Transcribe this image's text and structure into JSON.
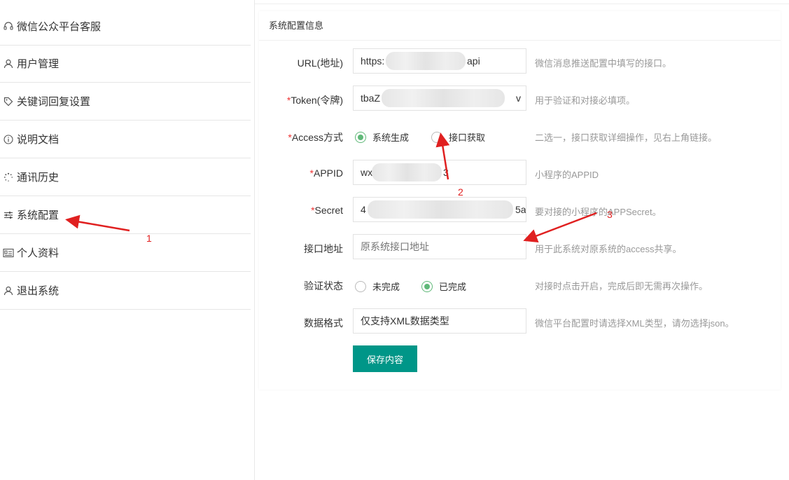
{
  "sidebar": {
    "items": [
      {
        "label": "微信公众平台客服",
        "icon": "headset-icon"
      },
      {
        "label": "用户管理",
        "icon": "user-icon"
      },
      {
        "label": "关键词回复设置",
        "icon": "tag-icon"
      },
      {
        "label": "说明文档",
        "icon": "info-icon"
      },
      {
        "label": "通讯历史",
        "icon": "loading-icon"
      },
      {
        "label": "系统配置",
        "icon": "sliders-icon"
      },
      {
        "label": "个人资料",
        "icon": "profile-card-icon"
      },
      {
        "label": "退出系统",
        "icon": "user-icon"
      }
    ]
  },
  "form": {
    "title": "系统配置信息",
    "url": {
      "label": "URL(地址)",
      "value_start": "https:",
      "value_end": "api",
      "hint": "微信消息推送配置中填写的接口。"
    },
    "token": {
      "required": "*",
      "label": "Token(令牌)",
      "value_start": "tbaZ",
      "value_end": "v",
      "hint": "用于验证和对接必填项。"
    },
    "access": {
      "required": "*",
      "label": "Access方式",
      "options": [
        "系统生成",
        "接口获取"
      ],
      "selected": "系统生成",
      "hint": "二选一，接口获取详细操作，见右上角链接。"
    },
    "appid": {
      "required": "*",
      "label": "APPID",
      "value_start": "wx",
      "value_end": "3",
      "hint": "小程序的APPID"
    },
    "secret": {
      "required": "*",
      "label": "Secret",
      "value_start": "4",
      "value_end": "5a",
      "hint": "要对接的小程序的APPSecret。"
    },
    "interface": {
      "label": "接口地址",
      "placeholder": "原系统接口地址",
      "hint": "用于此系统对原系统的access共享。"
    },
    "verify": {
      "label": "验证状态",
      "options": [
        "未完成",
        "已完成"
      ],
      "selected": "已完成",
      "hint": "对接时点击开启，完成后即无需再次操作。"
    },
    "format": {
      "label": "数据格式",
      "value": "仅支持XML数据类型",
      "hint": "微信平台配置时请选择XML类型，请勿选择json。"
    },
    "save_label": "保存内容"
  },
  "annotations": {
    "one": "1",
    "two": "2",
    "three": "3",
    "color": "#e02020"
  },
  "colors": {
    "accent": "#009688",
    "radio_on": "#5fb878",
    "required": "#e33333"
  }
}
